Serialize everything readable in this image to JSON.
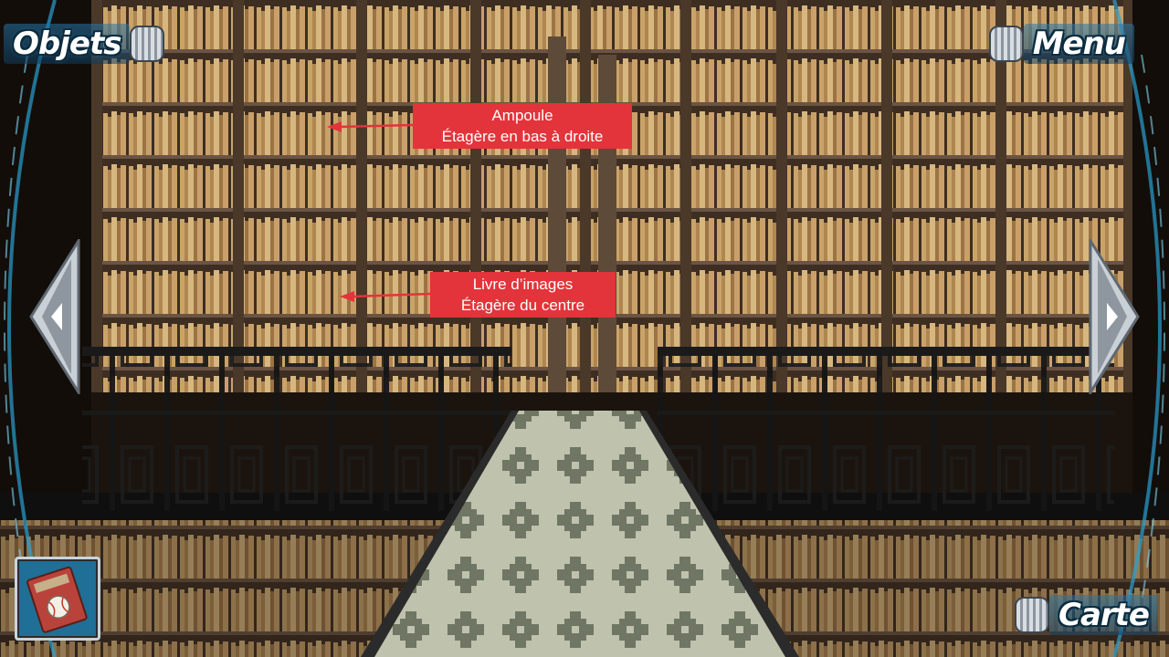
{
  "hud": {
    "items_label": "Objets",
    "menu_label": "Menu",
    "map_label": "Carte"
  },
  "annotations": [
    {
      "title": "Ampoule",
      "location": "Étagère en bas à droite"
    },
    {
      "title": "Livre d’images",
      "location": "Étagère du centre"
    }
  ],
  "inventory": {
    "icon": "baseball-book-icon"
  },
  "navigation": {
    "left_icon": "chevron-left-icon",
    "right_icon": "chevron-right-icon"
  },
  "colors": {
    "annotation_bg": "#e2343a",
    "annotation_arrow": "#e2343a",
    "hud_ring": "#2aa0d0",
    "shelf_wood": "#5a4636",
    "books": "#c9a46a",
    "carpet": "#b9bca6"
  }
}
